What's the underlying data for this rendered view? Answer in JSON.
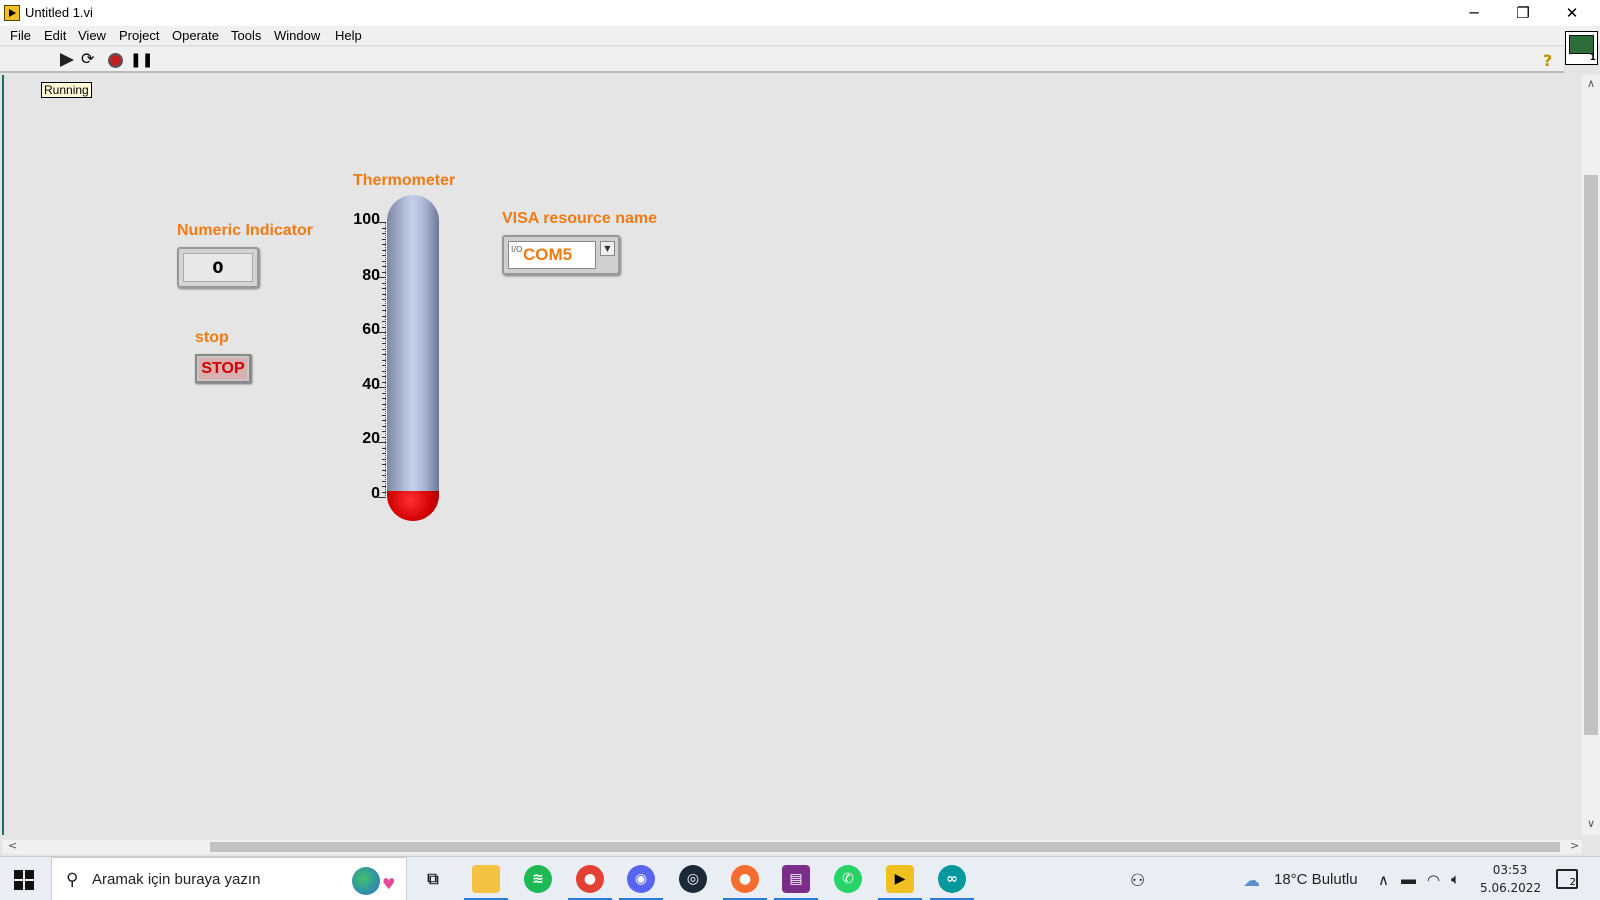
{
  "window": {
    "title": "Untitled 1.vi",
    "minimize": "─",
    "restore": "❐",
    "close": "✕"
  },
  "menu": [
    "File",
    "Edit",
    "View",
    "Project",
    "Operate",
    "Tools",
    "Window",
    "Help"
  ],
  "toolbar": {
    "status": "Running",
    "help": "?"
  },
  "vi_icon_badge": "1",
  "panel": {
    "numeric_indicator": {
      "label": "Numeric Indicator",
      "value": "0"
    },
    "stop": {
      "label": "stop",
      "button_text": "STOP"
    },
    "thermometer": {
      "label": "Thermometer",
      "ticks": [
        "100",
        "80",
        "60",
        "40",
        "20",
        "0"
      ],
      "value": 0,
      "fill_color": "#d10000",
      "tube_color": "#b3bedb"
    },
    "visa": {
      "label": "VISA resource name",
      "value": "COM5",
      "glyph": "I/O"
    },
    "label_color": "#f07b12"
  },
  "taskbar": {
    "search_placeholder": "Aramak için buraya yazın",
    "weather": "18°C  Bulutlu",
    "time": "03:53",
    "date": "5.06.2022",
    "notifications": "2",
    "apps": [
      "task-view",
      "file-explorer",
      "spotify",
      "chrome",
      "discord",
      "steam",
      "origin",
      "winrar",
      "whatsapp",
      "labview",
      "arduino"
    ]
  }
}
